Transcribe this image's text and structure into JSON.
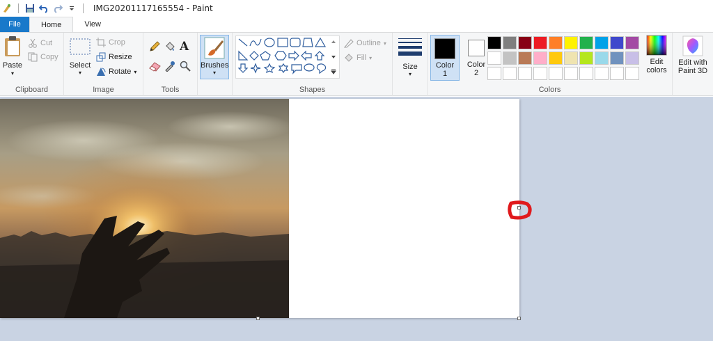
{
  "window": {
    "title": "IMG20201117165554 - Paint"
  },
  "tabs": [
    {
      "label": "File"
    },
    {
      "label": "Home"
    },
    {
      "label": "View"
    }
  ],
  "clipboard": {
    "paste_label": "Paste",
    "cut_label": "Cut",
    "copy_label": "Copy",
    "group_label": "Clipboard"
  },
  "image": {
    "select_label": "Select",
    "crop_label": "Crop",
    "resize_label": "Resize",
    "rotate_label": "Rotate",
    "group_label": "Image"
  },
  "tools": {
    "group_label": "Tools",
    "items": [
      "pencil-icon",
      "fill-bucket-icon",
      "text-icon",
      "eraser-icon",
      "color-picker-icon",
      "magnifier-icon"
    ]
  },
  "brushes": {
    "label": "Brushes"
  },
  "shapes": {
    "outline_label": "Outline",
    "fill_label": "Fill",
    "group_label": "Shapes"
  },
  "size": {
    "label": "Size"
  },
  "colors": {
    "color1_label": "Color",
    "color1_num": "1",
    "color2_label": "Color",
    "color2_num": "2",
    "edit_colors_line1": "Edit",
    "edit_colors_line2": "colors",
    "group_label": "Colors",
    "color1_value": "#000000",
    "color2_value": "#ffffff",
    "palette_row1": [
      "#000000",
      "#7f7f7f",
      "#880015",
      "#ed1c24",
      "#ff7f27",
      "#fff200",
      "#22b14c",
      "#00a2e8",
      "#3f48cc",
      "#a349a4"
    ],
    "palette_row2": [
      "#ffffff",
      "#c3c3c3",
      "#b97a57",
      "#ffaec9",
      "#ffc90e",
      "#efe4b0",
      "#b5e61d",
      "#99d9ea",
      "#7092be",
      "#c8bfe7"
    ],
    "palette_row3": [
      "#ffffff",
      "#ffffff",
      "#ffffff",
      "#ffffff",
      "#ffffff",
      "#ffffff",
      "#ffffff",
      "#ffffff",
      "#ffffff",
      "#ffffff"
    ]
  },
  "paint3d": {
    "line1": "Edit with",
    "line2": "Paint 3D"
  },
  "accent": "#1979ca",
  "annotation_color": "#e0191c"
}
